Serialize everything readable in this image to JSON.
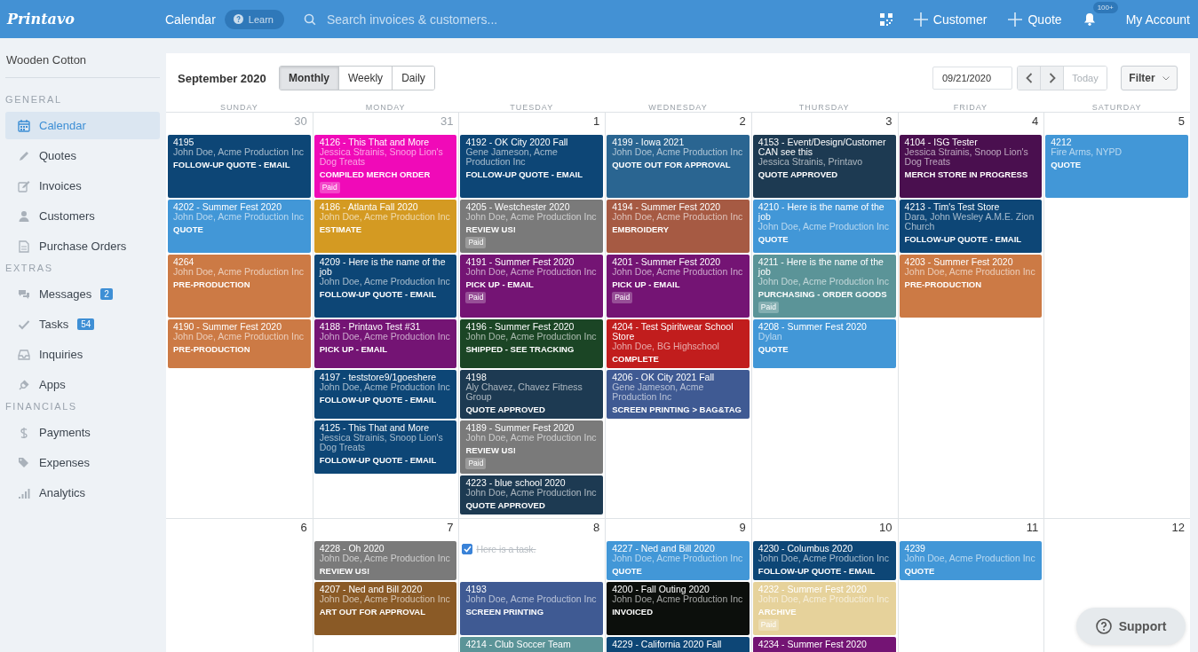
{
  "topbar": {
    "logo": "Printavo",
    "page_title": "Calendar",
    "learn_button": "Learn",
    "search": {
      "placeholder": "Search invoices & customers..."
    },
    "actions": [
      "Customer",
      "Quote"
    ],
    "notifications_badge": "100+",
    "account": "My Account"
  },
  "sidebar": {
    "company": "Wooden Cotton",
    "sections": [
      {
        "heading": "GENERAL",
        "items": [
          {
            "label": "Calendar",
            "selected": true
          },
          {
            "label": "Quotes",
            "selected": false
          },
          {
            "label": "Invoices",
            "selected": false
          },
          {
            "label": "Customers",
            "selected": false
          },
          {
            "label": "Purchase Orders",
            "selected": false
          }
        ]
      },
      {
        "heading": "EXTRAS",
        "items": [
          {
            "label": "Messages",
            "selected": false,
            "badge": "2"
          },
          {
            "label": "Tasks",
            "selected": false,
            "badge": "54"
          },
          {
            "label": "Inquiries",
            "selected": false
          },
          {
            "label": "Apps",
            "selected": false
          }
        ]
      },
      {
        "heading": "FINANCIALS",
        "items": [
          {
            "label": "Payments",
            "selected": false
          },
          {
            "label": "Expenses",
            "selected": false
          },
          {
            "label": "Analytics",
            "selected": false
          }
        ]
      }
    ]
  },
  "calendar": {
    "month": "September 2020",
    "views": [
      {
        "label": "Monthly",
        "selected": true
      },
      {
        "label": "Weekly",
        "selected": false
      },
      {
        "label": "Daily",
        "selected": false
      }
    ],
    "date": "09/21/2020",
    "today_button": {
      "label": "Today",
      "disabled": true
    },
    "filter": "Filter",
    "weekdays": [
      "SUNDAY",
      "MONDAY",
      "TUESDAY",
      "WEDNESDAY",
      "THURSDAY",
      "FRIDAY",
      "SATURDAY"
    ],
    "weeks": [
      {
        "days": [
          {
            "date": "30",
            "other_month": true,
            "items": [
              {
                "kind": "job",
                "title": "4195",
                "customer": "John Doe, Acme Production Inc",
                "status": "FOLLOW-UP QUOTE - EMAIL",
                "color": "#0d4676"
              },
              {
                "kind": "job",
                "title": "4202 - Summer Fest 2020",
                "customer": "John Doe, Acme Production Inc",
                "status": "QUOTE",
                "color": "#4297d7"
              },
              {
                "kind": "job",
                "title": "4264",
                "customer": "John Doe, Acme Production Inc",
                "status": "PRE-PRODUCTION",
                "color": "#cc7a45"
              },
              {
                "kind": "job",
                "title": "4190 - Summer Fest 2020",
                "customer": "John Doe, Acme Production Inc",
                "status": "PRE-PRODUCTION",
                "color": "#cc7a45"
              }
            ]
          },
          {
            "date": "31",
            "other_month": true,
            "items": [
              {
                "kind": "job",
                "title": "4126 - This That and More",
                "customer": "Jessica Strainis, Snoop Lion's Dog Treats",
                "status": "COMPILED MERCH ORDER",
                "color": "#f00ab8",
                "badge": "Paid"
              },
              {
                "kind": "job",
                "title": "4186 - Atlanta Fall 2020",
                "customer": "John Doe, Acme Production Inc",
                "status": "ESTIMATE",
                "color": "#d49a22"
              },
              {
                "kind": "job",
                "title": "4209 - Here is the name of the job",
                "customer": "John Doe, Acme Production Inc",
                "status": "FOLLOW-UP QUOTE - EMAIL",
                "color": "#0d4676"
              },
              {
                "kind": "job",
                "title": "4188 - Printavo Test #31",
                "customer": "John Doe, Acme Production Inc",
                "status": "PICK UP - EMAIL",
                "color": "#741474"
              },
              {
                "kind": "job",
                "title": "4197 - teststore9/1goeshere",
                "customer": "John Doe, Acme Production Inc",
                "status": "FOLLOW-UP QUOTE - EMAIL",
                "color": "#0d4676"
              },
              {
                "kind": "job",
                "title": "4125 - This That and More",
                "customer": "Jessica Strainis, Snoop Lion's Dog Treats",
                "status": "FOLLOW-UP QUOTE - EMAIL",
                "color": "#0d4676"
              }
            ]
          },
          {
            "date": "1",
            "other_month": false,
            "items": [
              {
                "kind": "job",
                "title": "4192 - OK City 2020 Fall",
                "customer": "Gene Jameson, Acme Production Inc",
                "status": "FOLLOW-UP QUOTE - EMAIL",
                "color": "#0d4676"
              },
              {
                "kind": "job",
                "title": "4205 - Westchester 2020",
                "customer": "John Doe, Acme Production Inc",
                "status": "REVIEW US!",
                "color": "#7a7a7a",
                "badge": "Paid"
              },
              {
                "kind": "job",
                "title": "4191 - Summer Fest 2020",
                "customer": "John Doe, Acme Production Inc",
                "status": "PICK UP - EMAIL",
                "color": "#741474",
                "badge": "Paid"
              },
              {
                "kind": "job",
                "title": "4196 - Summer Fest 2020",
                "customer": "John Doe, Acme Production Inc",
                "status": "SHIPPED - SEE TRACKING",
                "color": "#1b4525"
              },
              {
                "kind": "job",
                "title": "4198",
                "customer": "Aly Chavez, Chavez Fitness Group",
                "status": "QUOTE APPROVED",
                "color": "#1d3a52"
              },
              {
                "kind": "job",
                "title": "4189 - Summer Fest 2020",
                "customer": "John Doe, Acme Production Inc",
                "status": "REVIEW US!",
                "color": "#7a7a7a",
                "badge": "Paid"
              },
              {
                "kind": "job",
                "title": "4223 - blue school 2020",
                "customer": "John Doe, Acme Production Inc",
                "status": "QUOTE APPROVED",
                "color": "#1d3a52"
              }
            ]
          },
          {
            "date": "2",
            "other_month": false,
            "items": [
              {
                "kind": "job",
                "title": "4199 - Iowa 2021",
                "customer": "John Doe, Acme Production Inc",
                "status": "QUOTE OUT FOR APPROVAL",
                "color": "#2a6591"
              },
              {
                "kind": "job",
                "title": "4194 - Summer Fest 2020",
                "customer": "John Doe, Acme Production Inc",
                "status": "EMBROIDERY",
                "color": "#a65a43"
              },
              {
                "kind": "job",
                "title": "4201 - Summer Fest 2020",
                "customer": "John Doe, Acme Production Inc",
                "status": "PICK UP - EMAIL",
                "color": "#741474",
                "badge": "Paid"
              },
              {
                "kind": "job",
                "title": "4204 - Test Spiritwear School Store",
                "customer": "John Doe, BG Highschool",
                "status": "COMPLETE",
                "color": "#c11d1d"
              },
              {
                "kind": "job",
                "title": "4206 - OK City 2021 Fall",
                "customer": "Gene Jameson, Acme Production Inc",
                "status": "SCREEN PRINTING > BAG&TAG",
                "color": "#3f5a93"
              }
            ]
          },
          {
            "date": "3",
            "other_month": false,
            "items": [
              {
                "kind": "job",
                "title": "4153 - Event/Design/Customer CAN see this",
                "customer": "Jessica Strainis, Printavo",
                "status": "QUOTE APPROVED",
                "color": "#1d3a52"
              },
              {
                "kind": "job",
                "title": "4210 - Here is the name of the job",
                "customer": "John Doe, Acme Production Inc",
                "status": "QUOTE",
                "color": "#4297d7"
              },
              {
                "kind": "job",
                "title": "4211 - Here is the name of the job",
                "customer": "John Doe, Acme Production Inc",
                "status": "PURCHASING - ORDER GOODS",
                "color": "#5b9498",
                "badge": "Paid"
              },
              {
                "kind": "job",
                "title": "4208 - Summer Fest 2020",
                "customer": "Dylan",
                "status": "QUOTE",
                "color": "#4297d7"
              }
            ]
          },
          {
            "date": "4",
            "other_month": false,
            "items": [
              {
                "kind": "job",
                "title": "4104 - ISG Tester",
                "customer": "Jessica Strainis, Snoop Lion's Dog Treats",
                "status": "MERCH STORE IN PROGRESS",
                "color": "#4a0f4f"
              },
              {
                "kind": "job",
                "title": "4213 - Tim's Test Store",
                "customer": "Dara, John Wesley A.M.E. Zion Church",
                "status": "FOLLOW-UP QUOTE - EMAIL",
                "color": "#0d4676"
              },
              {
                "kind": "job",
                "title": "4203 - Summer Fest 2020",
                "customer": "John Doe, Acme Production Inc",
                "status": "PRE-PRODUCTION",
                "color": "#cc7a45"
              }
            ]
          },
          {
            "date": "5",
            "other_month": false,
            "items": [
              {
                "kind": "job",
                "title": "4212",
                "customer": "Fire Arms, NYPD",
                "status": "QUOTE",
                "color": "#4297d7"
              }
            ]
          }
        ]
      },
      {
        "days": [
          {
            "date": "6",
            "other_month": false
          },
          {
            "date": "7",
            "other_month": false,
            "items": [
              {
                "kind": "job",
                "title": "4228 - Oh 2020",
                "customer": "John Doe, Acme Production Inc",
                "status": "REVIEW US!",
                "color": "#7a7a7a"
              },
              {
                "kind": "job",
                "title": "4207 - Ned and Bill 2020",
                "customer": "John Doe, Acme Production Inc",
                "status": "ART OUT FOR APPROVAL",
                "color": "#8a5a26"
              }
            ]
          },
          {
            "date": "8",
            "other_month": false,
            "items": [
              {
                "kind": "task",
                "text": "Here is a task.",
                "checked": true
              },
              {
                "kind": "job",
                "title": "4193",
                "customer": "John Doe, Acme Production Inc",
                "status": "SCREEN PRINTING",
                "color": "#3f5a93"
              },
              {
                "kind": "job",
                "title": "4214 - Club Soccer Team",
                "color": "#5b9498"
              }
            ]
          },
          {
            "date": "9",
            "other_month": false,
            "items": [
              {
                "kind": "job",
                "title": "4227 - Ned and Bill 2020",
                "customer": "John Doe, Acme Production Inc",
                "status": "QUOTE",
                "color": "#4297d7"
              },
              {
                "kind": "job",
                "title": "4200 - Fall Outing 2020",
                "customer": "John Doe, Acme Production Inc",
                "status": "INVOICED",
                "color": "#0c0f0c"
              },
              {
                "kind": "job",
                "title": "4229 - California 2020 Fall",
                "color": "#0d4676"
              }
            ]
          },
          {
            "date": "10",
            "other_month": false,
            "items": [
              {
                "kind": "job",
                "title": "4230 - Columbus 2020",
                "customer": "John Doe, Acme Production Inc",
                "status": "FOLLOW-UP QUOTE - EMAIL",
                "color": "#0d4676"
              },
              {
                "kind": "job",
                "title": "4232 - Summer Fest 2020",
                "customer": "John Doe, Acme Production Inc",
                "status": "ARCHIVE",
                "color": "#e6d29b",
                "badge": "Paid"
              },
              {
                "kind": "job",
                "title": "4234 - Summer Fest 2020",
                "color": "#741474"
              }
            ]
          },
          {
            "date": "11",
            "other_month": false,
            "items": [
              {
                "kind": "job",
                "title": "4239",
                "customer": "John Doe, Acme Production Inc",
                "status": "QUOTE",
                "color": "#4297d7"
              }
            ]
          },
          {
            "date": "12",
            "other_month": false
          }
        ]
      }
    ]
  },
  "support_button": "Support"
}
